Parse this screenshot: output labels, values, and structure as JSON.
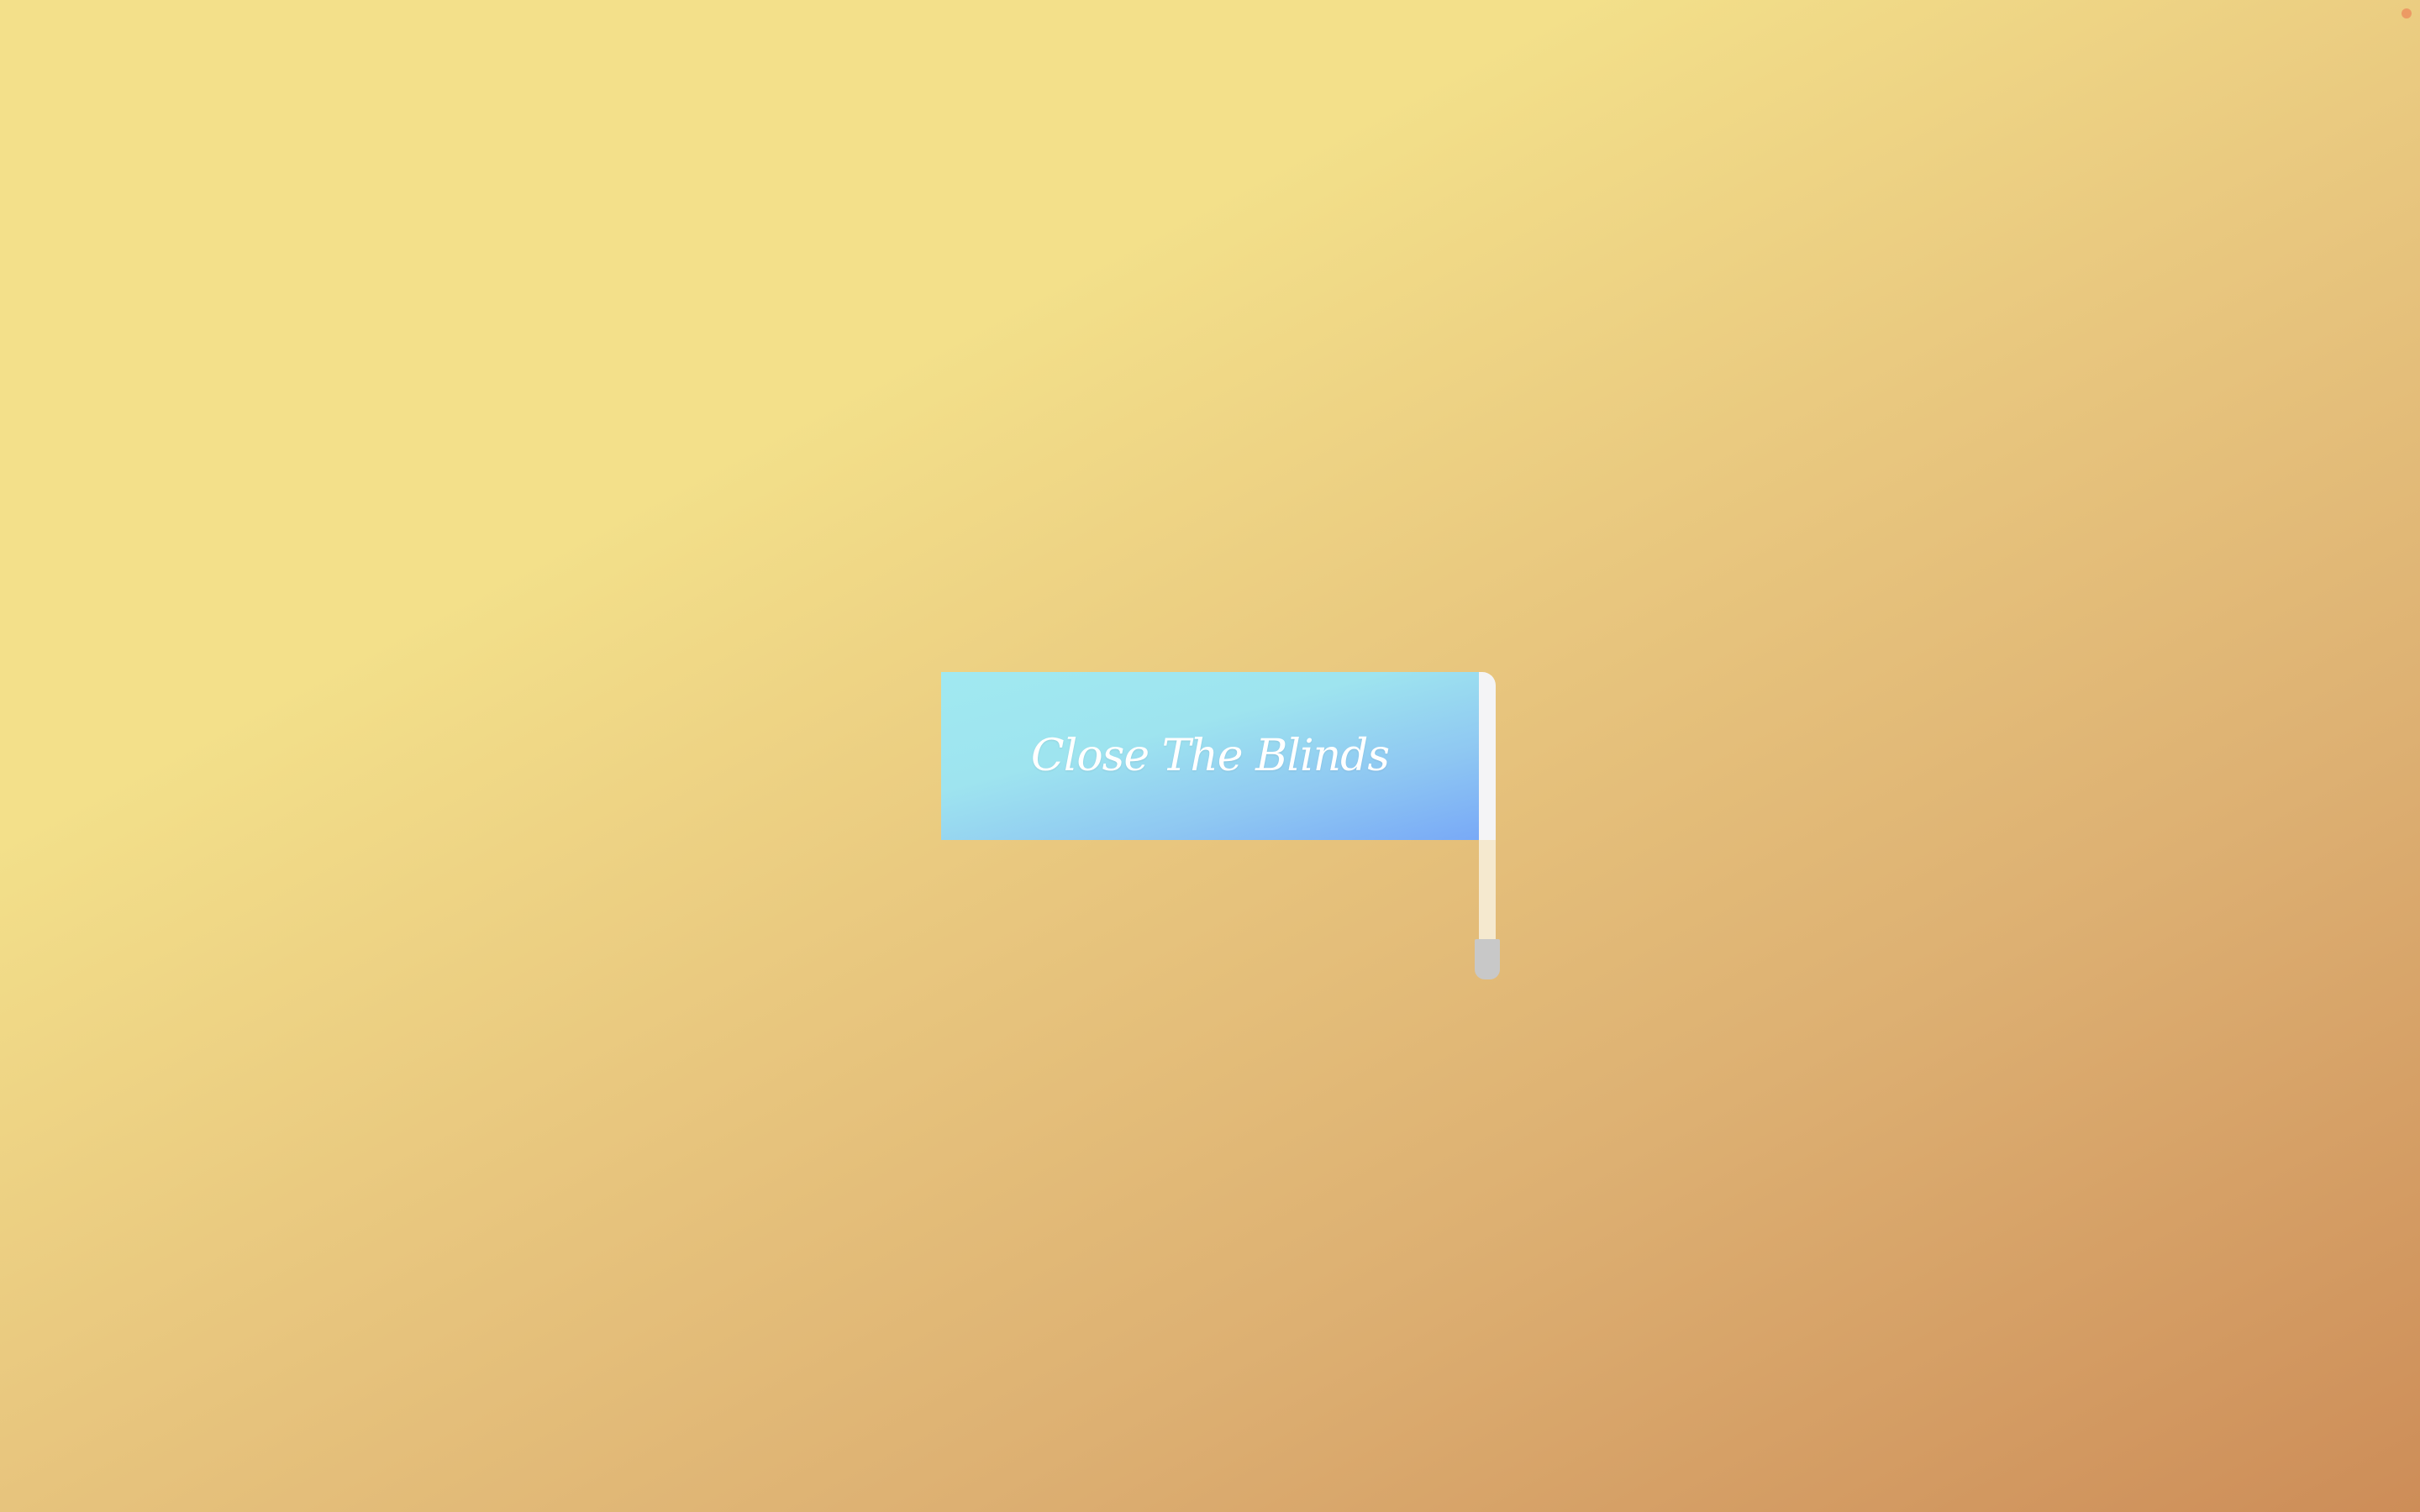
{
  "blinds": {
    "label": "Close The Blinds",
    "state": "open"
  },
  "colors": {
    "background_start": "#f3e08a",
    "background_end": "#cd8d58",
    "panel_start": "#a0e9f1",
    "panel_end": "#78a9f7",
    "rail": "#f4f4f6",
    "pull_handle": "#c8c8c8",
    "corner_dot": "#ec9a64"
  },
  "icons": {
    "corner_indicator": "status-dot-icon"
  }
}
